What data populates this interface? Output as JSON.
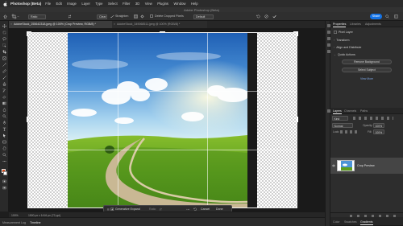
{
  "menubar": {
    "app_name": "Photoshop (Beta)",
    "items": [
      "File",
      "Edit",
      "Image",
      "Layer",
      "Type",
      "Select",
      "Filter",
      "3D",
      "View",
      "Plugins",
      "Window",
      "Help"
    ]
  },
  "window": {
    "title": "Adobe Photoshop (Beta)"
  },
  "options": {
    "ratio_select": "Ratio",
    "clear_label": "Clear",
    "straighten_label": "Straighten",
    "delete_cropped_label": "Delete Cropped Pixels",
    "fill_select": "Default",
    "share_label": "Share"
  },
  "tabs": [
    {
      "label": "AdobeStock_255642318.jpeg @ 100% (Crop Preview, RGB/8) *",
      "active": true
    },
    {
      "label": "AdobeStock_349068511.jpeg @ 100% (RGB/8) *",
      "active": false
    }
  ],
  "context_bar": {
    "generative_expand": "Generative Expand",
    "ratio_label": "Ratio",
    "cancel_label": "Cancel",
    "done_label": "Done"
  },
  "status": {
    "zoom": "100%",
    "doc_info": "1500 px x 1416 px (72 ppi)"
  },
  "bottom_tabs": [
    {
      "label": "Measurement Log",
      "active": false
    },
    {
      "label": "Timeline",
      "active": true
    }
  ],
  "panels": {
    "top_tabs": [
      {
        "label": "Properties",
        "active": true
      },
      {
        "label": "Libraries",
        "active": false
      },
      {
        "label": "Adjustments",
        "active": false
      }
    ],
    "pixel_layer": "Pixel Layer",
    "sections": [
      "Transform",
      "Align and Distribute",
      "Quick Actions"
    ],
    "remove_background": "Remove Background",
    "select_subject": "Select Subject",
    "view_more": "View More",
    "layer_tabs": [
      {
        "label": "Layers",
        "active": true
      },
      {
        "label": "Channels",
        "active": false
      },
      {
        "label": "Paths",
        "active": false
      }
    ],
    "kind_select": "Kind",
    "blend_mode": "Normal",
    "opacity_label": "Opacity:",
    "opacity_value": "100%",
    "lock_label": "Lock:",
    "fill_label": "Fill:",
    "fill_value": "100%",
    "layer_name": "Crop Preview",
    "bottom_tabs": [
      {
        "label": "Color",
        "active": false
      },
      {
        "label": "Swatches",
        "active": false
      },
      {
        "label": "Gradients",
        "active": true
      }
    ]
  },
  "icons": {
    "home": "home-icon",
    "crop_tool": "crop-icon",
    "share": "share-icon",
    "search": "search-icon",
    "settings": "gear-icon",
    "eye": "eye-icon"
  },
  "colors": {
    "accent": "#1473e6",
    "panel": "#2d2d2d",
    "canvas_bg": "#1a1a1a"
  }
}
